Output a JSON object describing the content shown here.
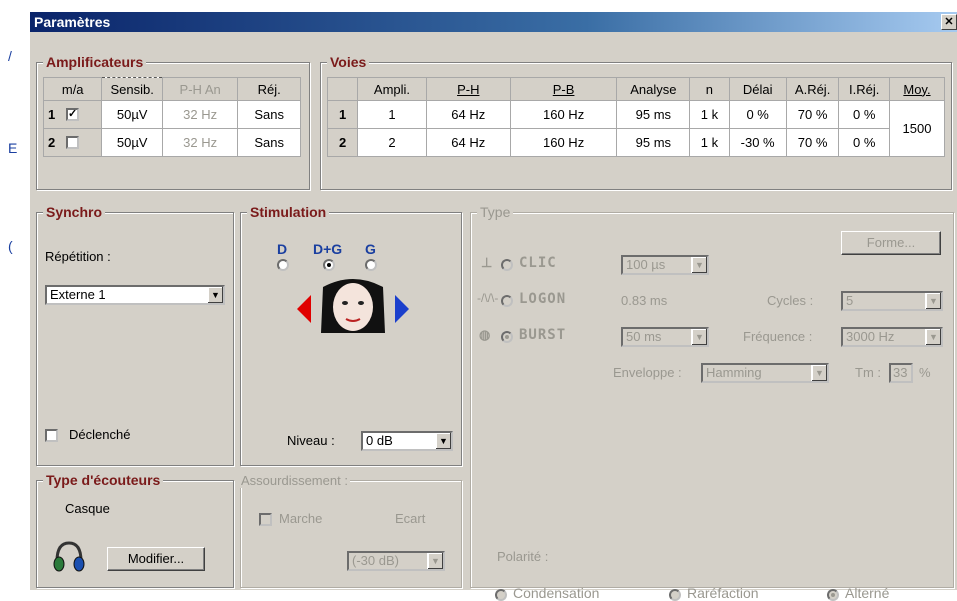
{
  "window": {
    "title": "Paramètres",
    "close_glyph": "✕"
  },
  "left_marks": [
    "/",
    "E",
    "("
  ],
  "amplificateurs": {
    "legend": "Amplificateurs",
    "headers": [
      "m/a",
      "Sensib.",
      "P-H An",
      "Réj."
    ],
    "rows": [
      {
        "num": "1",
        "checked": true,
        "sensib": "50µV",
        "ph": "32 Hz",
        "rej": "Sans"
      },
      {
        "num": "2",
        "checked": false,
        "sensib": "50µV",
        "ph": "32 Hz",
        "rej": "Sans"
      }
    ]
  },
  "voies": {
    "legend": "Voies",
    "headers": [
      "Ampli.",
      "P-H",
      "P-B",
      "Analyse",
      "n",
      "Délai",
      "A.Réj.",
      "I.Réj.",
      "Moy."
    ],
    "rows": [
      {
        "num": "1",
        "ampli": "1",
        "ph": "64 Hz",
        "pb": "160 Hz",
        "analyse": "95 ms",
        "n": "1 k",
        "delai": "0 %",
        "arej": "70 %",
        "irej": "0 %"
      },
      {
        "num": "2",
        "ampli": "2",
        "ph": "64 Hz",
        "pb": "160 Hz",
        "analyse": "95 ms",
        "n": "1 k",
        "delai": "-30 %",
        "arej": "70 %",
        "irej": "0 %"
      }
    ],
    "moy": "1500"
  },
  "synchro": {
    "legend": "Synchro",
    "repetition_label": "Répétition :",
    "repetition_value": "Externe 1",
    "declenche_label": "Déclenché"
  },
  "stimulation": {
    "legend": "Stimulation",
    "sides": [
      "D",
      "D+G",
      "G"
    ],
    "selected_side": "D+G",
    "niveau_label": "Niveau :",
    "niveau_value": "0 dB",
    "assourdissement_label": "Assourdissement :",
    "marche_label": "Marche",
    "ecart_label": "Ecart",
    "ecart_value": "(-30 dB)"
  },
  "type": {
    "legend": "Type",
    "forme_button": "Forme...",
    "clic_label": "CLIC",
    "clic_value": "100 µs",
    "logon_label": "LOGON",
    "logon_value": "0.83 ms",
    "cycles_label": "Cycles :",
    "cycles_value": "5",
    "burst_label": "BURST",
    "burst_value": "50 ms",
    "frequence_label": "Fréquence :",
    "frequence_value": "3000 Hz",
    "enveloppe_label": "Enveloppe :",
    "enveloppe_value": "Hamming",
    "tm_label": "Tm :",
    "tm_value": "33",
    "tm_unit": "%",
    "polarite_label": "Polarité :",
    "polarite_options": [
      "Condensation",
      "Raréfaction",
      "Alterné"
    ],
    "polarite_selected": "Alterné"
  },
  "ecouteurs": {
    "legend": "Type d'écouteurs",
    "value": "Casque",
    "modifier_button": "Modifier..."
  },
  "colors": {
    "titlebar": "#0a246a",
    "dialog": "#d4d0c8",
    "legend": "#7a1a1a",
    "stim_label": "#1a3fa0",
    "arrow_left": "#e00000",
    "arrow_right": "#1a3fcc",
    "disabled_text": "#9a9890"
  }
}
